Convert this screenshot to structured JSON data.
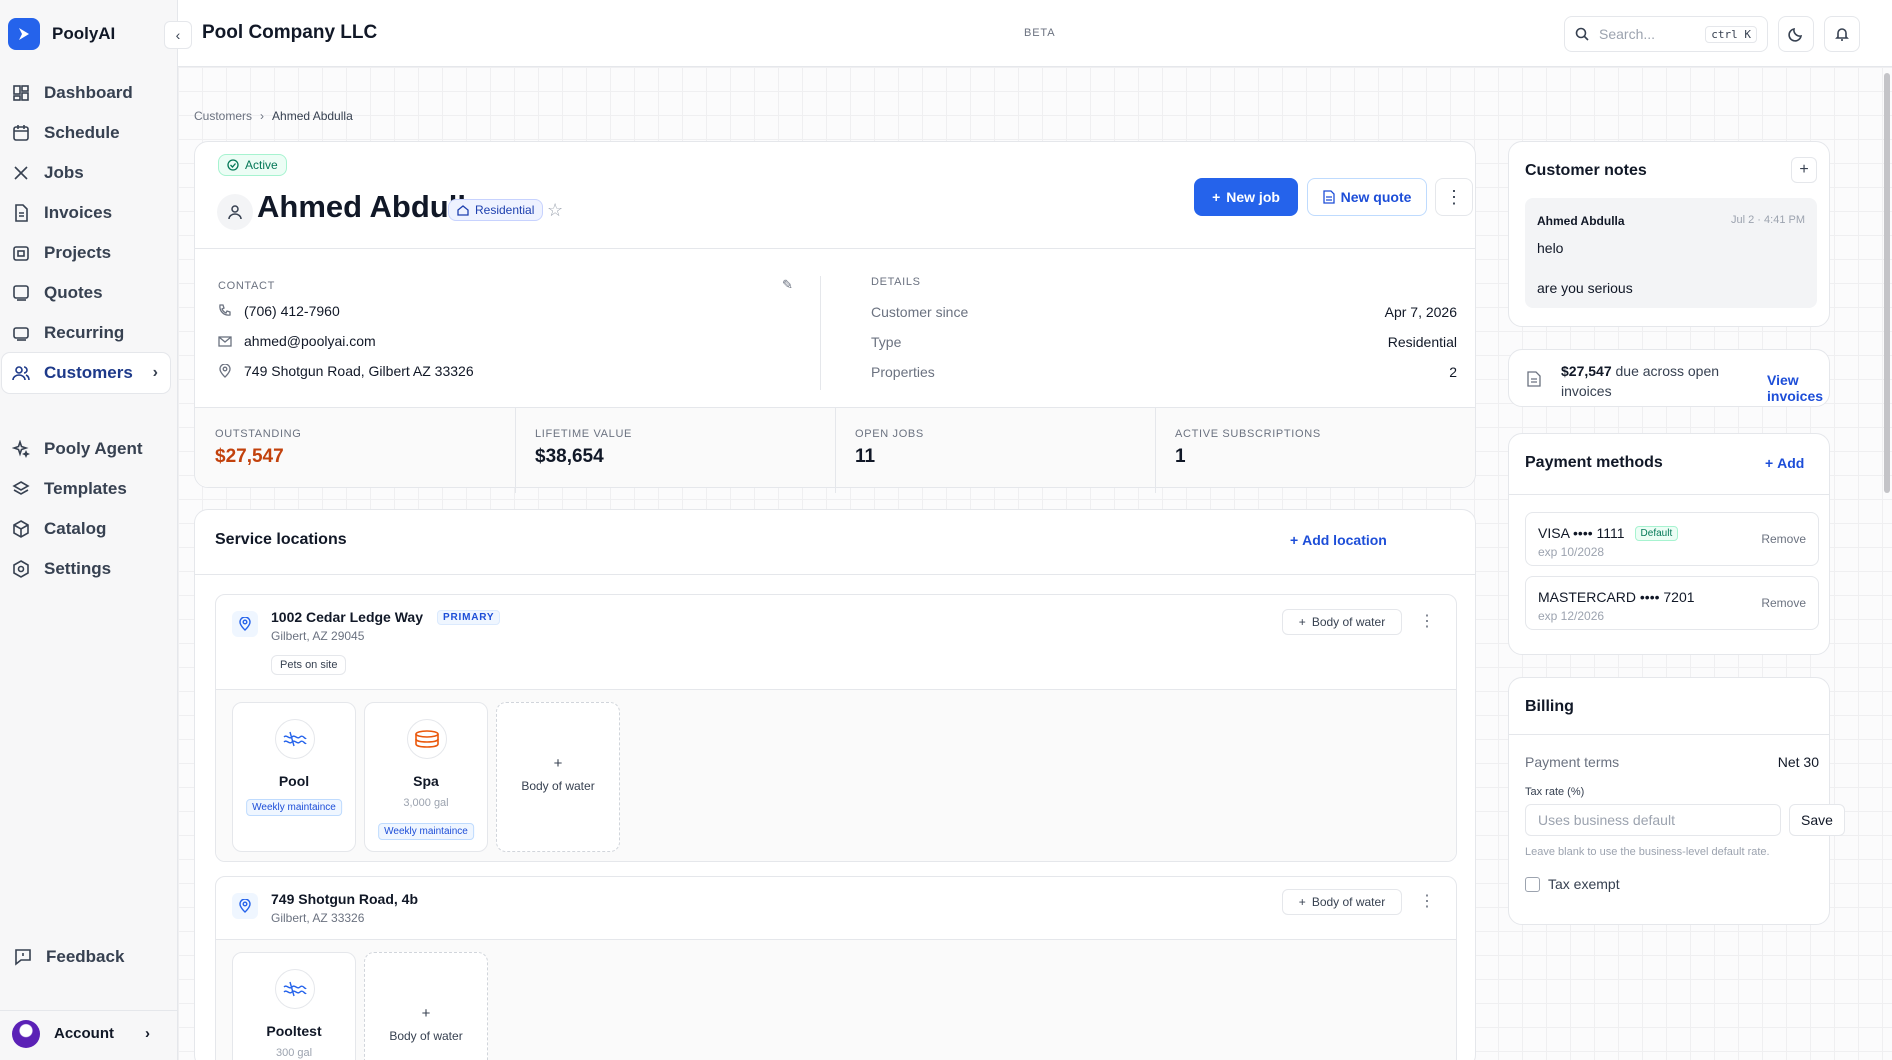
{
  "app": {
    "name": "PoolyAI",
    "company": "Pool Company LLC",
    "beta": "BETA"
  },
  "sidebar": {
    "items": [
      {
        "label": "Dashboard",
        "icon": "dashboard-icon"
      },
      {
        "label": "Schedule",
        "icon": "calendar-icon"
      },
      {
        "label": "Jobs",
        "icon": "tools-icon"
      },
      {
        "label": "Invoices",
        "icon": "invoice-icon"
      },
      {
        "label": "Projects",
        "icon": "projects-icon"
      },
      {
        "label": "Quotes",
        "icon": "quotes-icon"
      },
      {
        "label": "Recurring",
        "icon": "recurring-icon"
      },
      {
        "label": "Customers",
        "icon": "users-icon",
        "active": true
      }
    ],
    "secondary": [
      {
        "label": "Pooly Agent",
        "icon": "sparkles-icon"
      },
      {
        "label": "Templates",
        "icon": "layers-icon"
      },
      {
        "label": "Catalog",
        "icon": "box-icon"
      },
      {
        "label": "Settings",
        "icon": "gear-icon"
      }
    ],
    "feedback": "Feedback",
    "account": "Account"
  },
  "header": {
    "search_placeholder": "Search...",
    "shortcut": "ctrl K"
  },
  "breadcrumb": {
    "parent": "Customers",
    "current": "Ahmed Abdulla"
  },
  "customer": {
    "status": "Active",
    "name": "Ahmed Abdulla",
    "type_badge": "Residential",
    "new_job": "New job",
    "new_quote": "New quote",
    "contact_label": "CONTACT",
    "phone": "(706) 412-7960",
    "email": "ahmed@poolyai.com",
    "address": "749 Shotgun Road, Gilbert AZ 33326",
    "details_label": "DETAILS",
    "details": [
      {
        "k": "Customer since",
        "v": "Apr 7, 2026"
      },
      {
        "k": "Type",
        "v": "Residential"
      },
      {
        "k": "Properties",
        "v": "2"
      }
    ],
    "stats": [
      {
        "label": "OUTSTANDING",
        "value": "$27,547",
        "color": "#c2410c"
      },
      {
        "label": "LIFETIME VALUE",
        "value": "$38,654"
      },
      {
        "label": "OPEN JOBS",
        "value": "11"
      },
      {
        "label": "ACTIVE SUBSCRIPTIONS",
        "value": "1"
      }
    ]
  },
  "locations": {
    "title": "Service locations",
    "add_label": "Add location",
    "body_of_water_btn": "Body of water",
    "items": [
      {
        "address": "1002 Cedar Ledge Way",
        "city": "Gilbert, AZ 29045",
        "primary": "PRIMARY",
        "tag": "Pets on site",
        "waters": [
          {
            "name": "Pool",
            "gallons": "",
            "plan": "Weekly maintaince",
            "icon": "pool-icon"
          },
          {
            "name": "Spa",
            "gallons": "3,000 gal",
            "plan": "Weekly maintaince",
            "icon": "spa-icon"
          }
        ],
        "add_water": "Body of water"
      },
      {
        "address": "749 Shotgun Road, 4b",
        "city": "Gilbert, AZ 33326",
        "waters": [
          {
            "name": "Pooltest",
            "gallons": "300 gal",
            "icon": "pool-icon"
          }
        ],
        "add_water": "Body of water"
      }
    ]
  },
  "notes": {
    "title": "Customer notes",
    "author": "Ahmed Abdulla",
    "date": "Jul 2 · 4:41 PM",
    "lines": [
      "helo",
      "are you serious"
    ]
  },
  "due": {
    "amount": "$27,547",
    "text": "due across open invoices",
    "link": "View invoices"
  },
  "payment_methods": {
    "title": "Payment methods",
    "add": "Add",
    "cards": [
      {
        "name": "VISA •••• 1111",
        "exp": "exp 10/2028",
        "default": "Default",
        "remove": "Remove"
      },
      {
        "name": "MASTERCARD •••• 7201",
        "exp": "exp 12/2026",
        "remove": "Remove"
      }
    ]
  },
  "billing": {
    "title": "Billing",
    "terms_label": "Payment terms",
    "terms_value": "Net 30",
    "tax_label": "Tax rate (%)",
    "tax_placeholder": "Uses business default",
    "save": "Save",
    "hint": "Leave blank to use the business-level default rate.",
    "exempt": "Tax exempt"
  }
}
